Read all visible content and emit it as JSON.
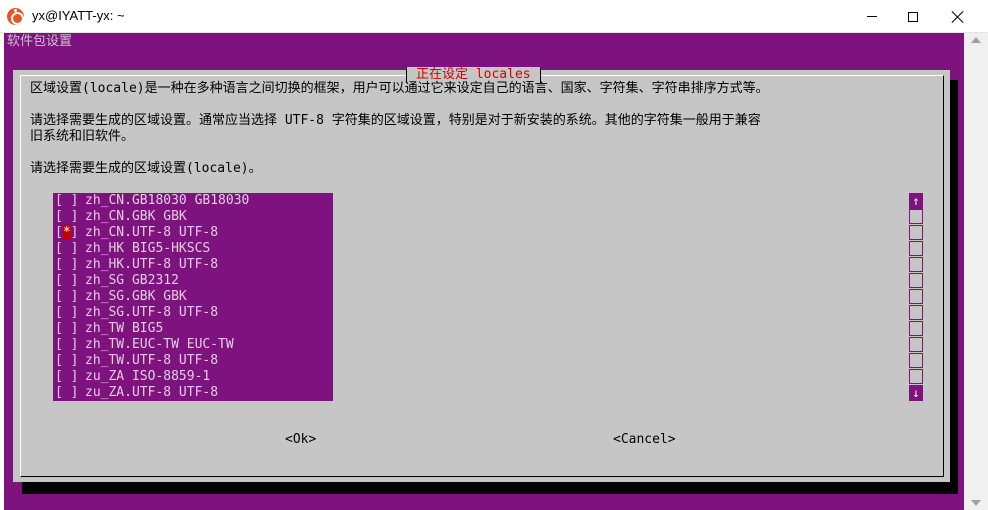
{
  "window": {
    "title": "yx@IYATT-yx: ~",
    "app_icon": "ubuntu-icon",
    "controls": [
      "minimize-icon",
      "maximize-icon",
      "close-icon"
    ]
  },
  "terminal": {
    "header": "软件包设置",
    "bg_color": "#7e127e"
  },
  "dialog": {
    "title": "正在设定 locales",
    "title_color": "#d40000",
    "lines": [
      "区域设置(locale)是一种在多种语言之间切换的框架，用户可以通过它来设定自己的语言、国家、字符集、字符串排序方式等。",
      "请选择需要生成的区域设置。通常应当选择 UTF-8 字符集的区域设置，特别是对于新安装的系统。其他的字符集一般用于兼容",
      "旧系统和旧软件。",
      "请选择需要生成的区域设置(locale)。"
    ],
    "items": [
      {
        "label": "zh_CN.GB18030 GB18030",
        "checked": false
      },
      {
        "label": "zh_CN.GBK GBK",
        "checked": false
      },
      {
        "label": "zh_CN.UTF-8 UTF-8",
        "checked": true
      },
      {
        "label": "zh_HK BIG5-HKSCS",
        "checked": false
      },
      {
        "label": "zh_HK.UTF-8 UTF-8",
        "checked": false
      },
      {
        "label": "zh_SG GB2312",
        "checked": false
      },
      {
        "label": "zh_SG.GBK GBK",
        "checked": false
      },
      {
        "label": "zh_SG.UTF-8 UTF-8",
        "checked": false
      },
      {
        "label": "zh_TW BIG5",
        "checked": false
      },
      {
        "label": "zh_TW.EUC-TW EUC-TW",
        "checked": false
      },
      {
        "label": "zh_TW.UTF-8 UTF-8",
        "checked": false
      },
      {
        "label": "zu_ZA ISO-8859-1",
        "checked": false
      },
      {
        "label": "zu_ZA.UTF-8 UTF-8",
        "checked": false
      }
    ],
    "checkbox_unchecked": "[ ]",
    "checkbox_checked_mark": "*",
    "scroll_up": "↑",
    "scroll_down": "↓",
    "ok_label": "<Ok>",
    "cancel_label": "<Cancel>"
  }
}
